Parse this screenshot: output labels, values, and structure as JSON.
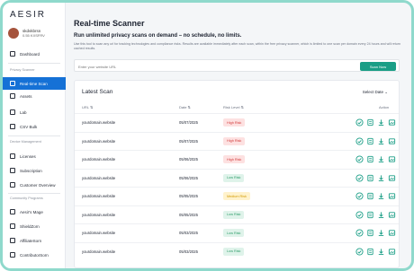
{
  "brand": {
    "logo_text": "AESIR"
  },
  "user": {
    "name": "skdvkbrsn",
    "id": "0.55 KXSFRV"
  },
  "sidebar": {
    "dashboard": "Dashboard",
    "sections": [
      {
        "title": "Privacy Scanner",
        "items": [
          "Real-time Scan",
          "Assets",
          "Lab",
          "CSV Bulk"
        ]
      },
      {
        "title": "Device Management",
        "items": [
          "Licenses",
          "Subscription",
          "Customer Overview"
        ]
      },
      {
        "title": "Community Programs",
        "items": [
          "Aesir's Mage",
          "ShieldZorn",
          "AffiliateSorn",
          "ContributorSorn"
        ]
      }
    ],
    "active_item": "Real-time Scan"
  },
  "main": {
    "title": "Real-time Scanner",
    "subtitle": "Run unlimited privacy scans on demand – no schedule, no limits.",
    "description": "Use this tool to scan any url for tracking technologies and compliance risks. Results are available immediately after each scan, within the free privacy scanner, which is limited to one scan per domain every 24 hours and will return cached results.",
    "url_placeholder": "Enter your website URL",
    "scan_button": "Scan Now",
    "latest_title": "Latest Scan",
    "sort_label": "Select Date",
    "columns": {
      "url": "URL ⇅",
      "date": "Date ⇅",
      "risk": "Risk Level ⇅",
      "action": "Action"
    },
    "rows": [
      {
        "url": "yourdomain.website",
        "date": "05/07/2025",
        "risk": "High Risk",
        "level": "high"
      },
      {
        "url": "yourdomain.website",
        "date": "05/07/2025",
        "risk": "High Risk",
        "level": "high"
      },
      {
        "url": "yourdomain.website",
        "date": "05/06/2025",
        "risk": "High Risk",
        "level": "high"
      },
      {
        "url": "yourdomain.website",
        "date": "05/06/2025",
        "risk": "Low Risk",
        "level": "low"
      },
      {
        "url": "yourdomain.website",
        "date": "05/05/2025",
        "risk": "Medium Risk",
        "level": "medium"
      },
      {
        "url": "yourdomain.website",
        "date": "05/05/2025",
        "risk": "Low Risk",
        "level": "low"
      },
      {
        "url": "yourdomain.website",
        "date": "05/03/2025",
        "risk": "Low Risk",
        "level": "low"
      },
      {
        "url": "yourdomain.website",
        "date": "05/03/2025",
        "risk": "Low Risk",
        "level": "low"
      }
    ]
  },
  "colors": {
    "accent": "#1a9e86",
    "sidebar_active": "#1571d6",
    "high": "#d23c3c",
    "low": "#2e9d6a",
    "medium": "#d29a00"
  },
  "icons": {
    "actions": [
      "check-circle-icon",
      "document-icon",
      "download-icon",
      "image-icon"
    ]
  }
}
